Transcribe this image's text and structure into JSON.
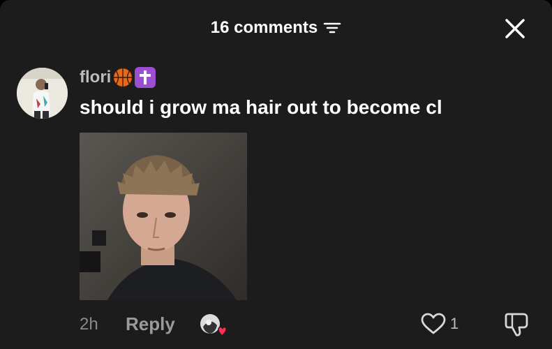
{
  "header": {
    "comment_count_label": "16 comments"
  },
  "comment": {
    "username": "flori",
    "username_emojis": [
      "basketball",
      "latin-cross"
    ],
    "text": "should i grow ma hair out to become cl",
    "time": "2h",
    "reply_label": "Reply",
    "like_count": "1"
  },
  "icons": {
    "sort": "sort-filter-icon",
    "close": "close-icon",
    "like": "heart-outline-icon",
    "dislike": "thumbs-down-icon",
    "creator_liked": "creator-liked-heart-badge"
  },
  "colors": {
    "background": "#1c1c1c",
    "primary_text": "#ffffff",
    "secondary_text": "#9a9a9a",
    "liked_heart": "#ff2e55",
    "cross_emoji_bg": "#9b4fd0",
    "basketball_emoji": "#e46b1c"
  }
}
